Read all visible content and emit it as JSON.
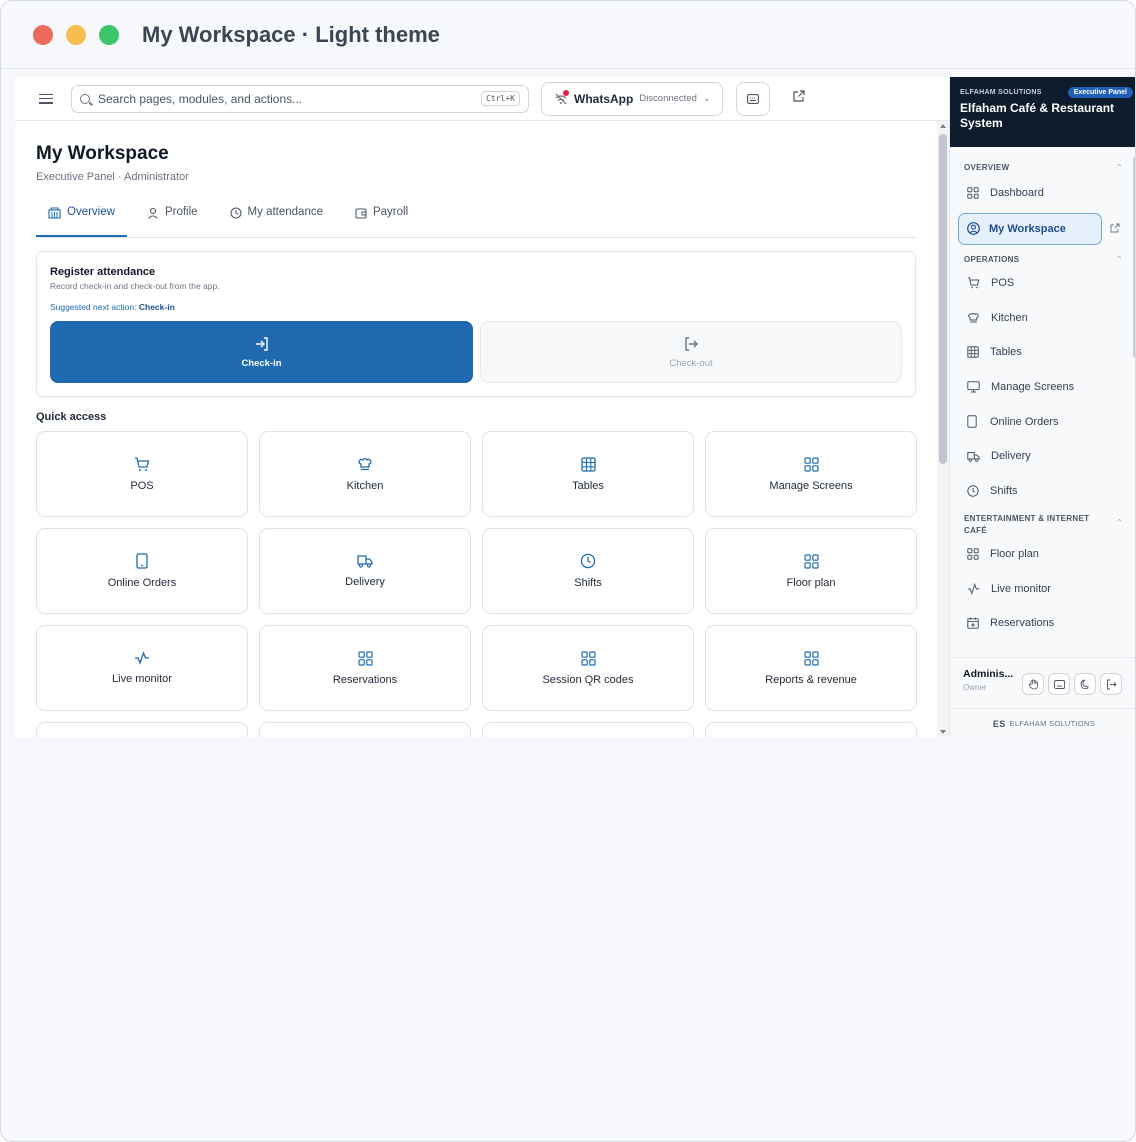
{
  "window": {
    "title": "My Workspace · Light theme"
  },
  "topbar": {
    "search_placeholder": "Search pages, modules, and actions...",
    "shortcut": "Ctrl+K",
    "whatsapp": {
      "name": "WhatsApp",
      "status": "Disconnected"
    }
  },
  "page": {
    "title": "My Workspace",
    "subtitle": "Executive Panel · Administrator",
    "tabs": [
      {
        "label": "Overview",
        "icon": "building-icon"
      },
      {
        "label": "Profile",
        "icon": "user-icon"
      },
      {
        "label": "My attendance",
        "icon": "clock-icon"
      },
      {
        "label": "Payroll",
        "icon": "wallet-icon"
      }
    ]
  },
  "attendance": {
    "title": "Register attendance",
    "subtitle": "Record check-in and check-out from the app.",
    "suggested_prefix": "Suggested next action:",
    "suggested_action": "Check-in",
    "checkin_label": "Check-in",
    "checkout_label": "Check-out"
  },
  "quick_access": {
    "title": "Quick access",
    "tiles": [
      {
        "label": "POS",
        "icon": "cart-icon"
      },
      {
        "label": "Kitchen",
        "icon": "chef-hat-icon"
      },
      {
        "label": "Tables",
        "icon": "table-grid-icon"
      },
      {
        "label": "Manage Screens",
        "icon": "layout-grid-icon"
      },
      {
        "label": "Online Orders",
        "icon": "tablet-icon"
      },
      {
        "label": "Delivery",
        "icon": "truck-icon"
      },
      {
        "label": "Shifts",
        "icon": "clock-icon"
      },
      {
        "label": "Floor plan",
        "icon": "layout-grid-icon"
      },
      {
        "label": "Live monitor",
        "icon": "activity-icon"
      },
      {
        "label": "Reservations",
        "icon": "layout-grid-icon"
      },
      {
        "label": "Session QR codes",
        "icon": "layout-grid-icon"
      },
      {
        "label": "Reports & revenue",
        "icon": "layout-grid-icon"
      }
    ]
  },
  "sidebar": {
    "brand": "ELFAHAM SOLUTIONS",
    "badge": "Executive Panel",
    "app_name": "Elfaham Café & Restaurant System",
    "sections": {
      "overview": "OVERVIEW",
      "operations": "OPERATIONS",
      "entertainment": "ENTERTAINMENT & INTERNET CAFÉ"
    },
    "items": {
      "dashboard": "Dashboard",
      "my_workspace": "My Workspace",
      "pos": "POS",
      "kitchen": "Kitchen",
      "tables": "Tables",
      "manage_screens": "Manage Screens",
      "online_orders": "Online Orders",
      "delivery": "Delivery",
      "shifts": "Shifts",
      "floor_plan": "Floor plan",
      "live_monitor": "Live monitor",
      "reservations": "Reservations"
    },
    "user": {
      "name": "Adminis...",
      "role": "Owner"
    },
    "footer": "ELFAHAM SOLUTIONS"
  },
  "colors": {
    "primary": "#1f69b1",
    "sidebar_header": "#0f1c2e",
    "active_bg": "#e6f0fb",
    "badge": "#1f5fb8",
    "alert": "#e11d48"
  }
}
